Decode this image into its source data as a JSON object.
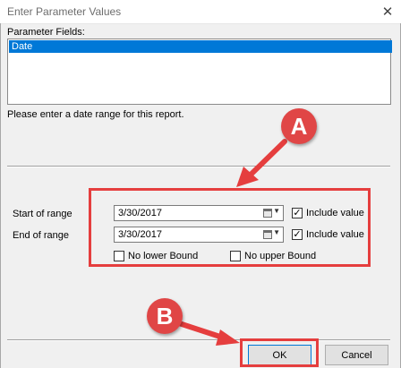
{
  "window": {
    "title": "Enter Parameter Values",
    "close_glyph": "✕"
  },
  "parameter_fields": {
    "label": "Parameter Fields:",
    "items": [
      "Date"
    ]
  },
  "hint": "Please enter a date range for this report.",
  "range": {
    "start_label": "Start of range",
    "end_label": "End of range",
    "start_value": "3/30/2017",
    "end_value": "3/30/2017",
    "include_value_label": "Include value",
    "check_glyph": "✓",
    "no_lower_bound_label": "No lower Bound",
    "no_upper_bound_label": "No upper Bound"
  },
  "buttons": {
    "ok": "OK",
    "cancel": "Cancel"
  },
  "annotations": {
    "a": "A",
    "b": "B",
    "color": "#e53e3e"
  },
  "colors": {
    "selection": "#0078d7",
    "dialog_bg": "#f0f0f0"
  }
}
